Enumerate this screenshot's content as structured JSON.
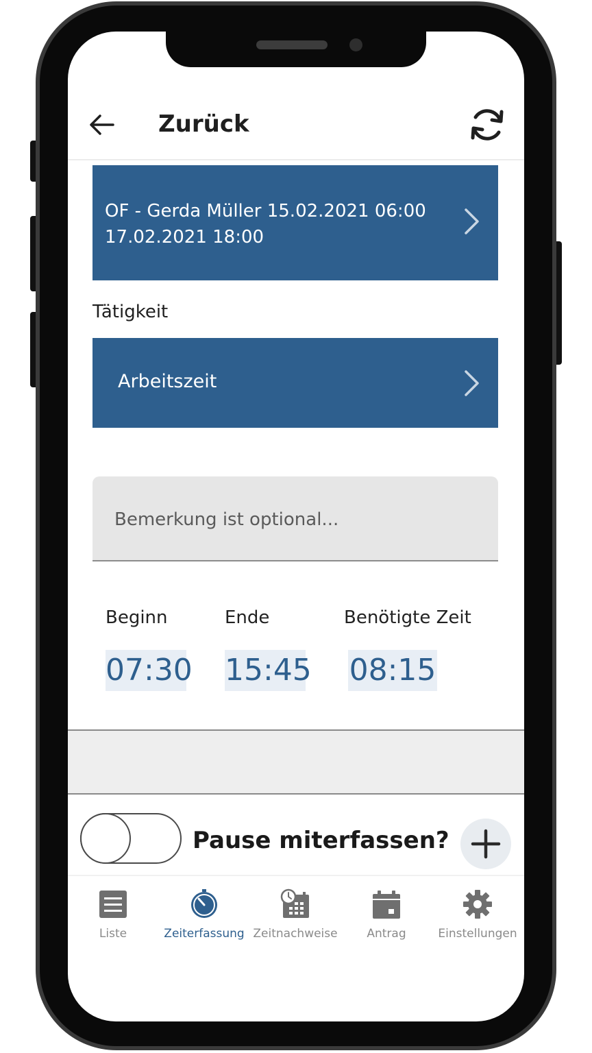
{
  "header": {
    "back_icon": "arrow-left-icon",
    "title": "Zurück",
    "refresh_icon": "refresh-icon"
  },
  "order_card": {
    "line1": "OF -  Gerda Müller 15.02.2021 06:00",
    "line2": "17.02.2021 18:00",
    "icon": "chevron-right-icon"
  },
  "activity": {
    "label": "Tätigkeit",
    "value": "Arbeitszeit",
    "icon": "chevron-right-icon"
  },
  "remark": {
    "placeholder": "Bemerkung ist optional...",
    "value": ""
  },
  "times": {
    "begin_label": "Beginn",
    "begin_value": "07:30",
    "end_label": "Ende",
    "end_value": "15:45",
    "duration_label": "Benötigte Zeit",
    "duration_value": "08:15"
  },
  "pause": {
    "label": "Pause miterfassen?",
    "enabled": false,
    "add_icon": "plus-icon"
  },
  "bottom_nav": {
    "active": "Zeiterfassung",
    "items": [
      {
        "label": "Liste",
        "icon": "list-icon"
      },
      {
        "label": "Zeiterfassung",
        "icon": "stopwatch-icon"
      },
      {
        "label": "Zeitnachweise",
        "icon": "calendar-clock-icon"
      },
      {
        "label": "Antrag",
        "icon": "calendar-icon"
      },
      {
        "label": "Einstellungen",
        "icon": "gear-icon"
      }
    ]
  },
  "colors": {
    "primary": "#2e5f8e",
    "time_value_bg": "#e8eef5",
    "nav_inactive": "#8a8a8a",
    "remark_bg": "#e6e6e6"
  }
}
